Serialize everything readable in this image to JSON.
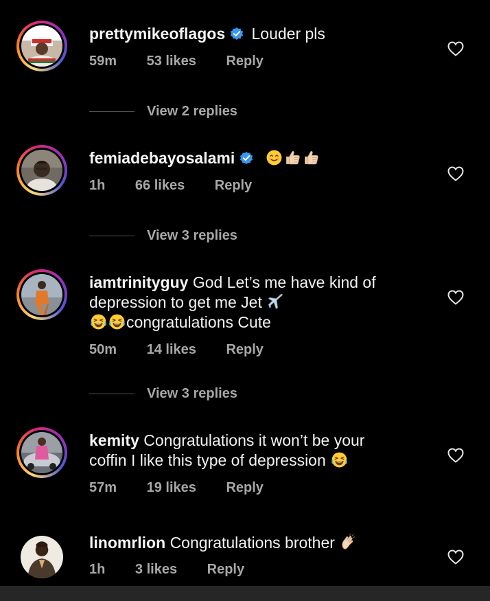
{
  "comments": [
    {
      "username": "prettymikeoflagos",
      "verified": true,
      "text": "Louder pls",
      "time": "59m",
      "likes": "53 likes",
      "reply": "Reply",
      "view_replies": "View 2 replies"
    },
    {
      "username": "femiadebayosalami",
      "verified": true,
      "text": "",
      "emojis": [
        "smiling-face-emoji",
        "thumbs-up-emoji",
        "thumbs-up-emoji"
      ],
      "time": "1h",
      "likes": "66 likes",
      "reply": "Reply",
      "view_replies": "View 3 replies"
    },
    {
      "username": "iamtrinityguy",
      "verified": false,
      "text_line1": "God Let’s me have kind of",
      "text_line2": "depression to get me Jet",
      "text_line3": "congratulations Cute",
      "emojis": [
        "airplane-emoji",
        "tears-of-joy-emoji",
        "tears-of-joy-emoji"
      ],
      "time": "50m",
      "likes": "14 likes",
      "reply": "Reply",
      "view_replies": "View 3 replies"
    },
    {
      "username": "kemity",
      "verified": false,
      "text_line1": "Congratulations it won’t be your",
      "text_line2": "coffin I like this type of depression",
      "emojis": [
        "tears-of-joy-emoji"
      ],
      "time": "57m",
      "likes": "19 likes",
      "reply": "Reply"
    },
    {
      "username": "linomrlion",
      "verified": false,
      "text": "Congratulations brother",
      "emojis": [
        "clapping-hands-emoji"
      ],
      "time": "1h",
      "likes": "3 likes",
      "reply": "Reply"
    }
  ],
  "colors": {
    "background": "#000000",
    "secondary_text": "#a8a8a8",
    "verified_blue": "#3897f0",
    "bottom_bar": "#262626"
  },
  "icons": [
    "heart-outline-icon",
    "verified-badge-icon"
  ]
}
